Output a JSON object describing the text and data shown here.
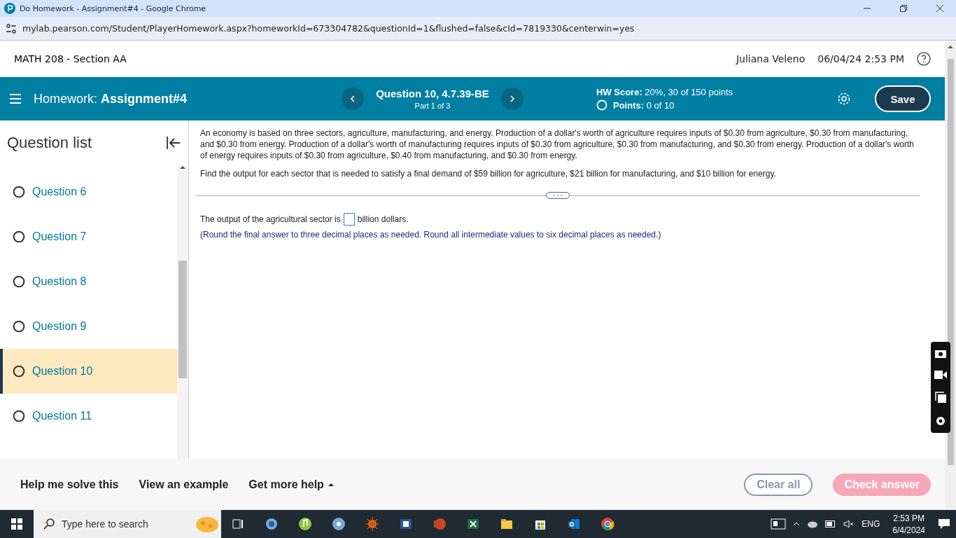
{
  "browser": {
    "title": "Do Homework - Assignment#4 - Google Chrome",
    "url": "mylab.pearson.com/Student/PlayerHomework.aspx?homeworkId=673304782&questionId=1&flushed=false&cId=7819330&centerwin=yes"
  },
  "header": {
    "course": "MATH 208 - Section AA",
    "user": "Juliana Veleno",
    "datetime": "06/04/24 2:53 PM"
  },
  "toolbar": {
    "homework_label": "Homework:",
    "assignment": "Assignment#4",
    "question_title": "Question 10, 4.7.39-BE",
    "part": "Part 1 of 3",
    "hw_score_label": "HW Score:",
    "hw_score": "20%, 30 of 150 points",
    "points_label": "Points:",
    "points": "0 of 10",
    "save": "Save"
  },
  "sidebar": {
    "title": "Question list",
    "items": [
      {
        "label": "Question 6",
        "selected": false
      },
      {
        "label": "Question 7",
        "selected": false
      },
      {
        "label": "Question 8",
        "selected": false
      },
      {
        "label": "Question 9",
        "selected": false
      },
      {
        "label": "Question 10",
        "selected": true
      },
      {
        "label": "Question 11",
        "selected": false
      }
    ]
  },
  "question": {
    "paragraphs": [
      "An economy is based on three sectors, agriculture, manufacturing, and energy. Production of a dollar's worth of agriculture requires inputs of $0.30 from agriculture,  $0.30 from manufacturing, and $0.30 from energy. Production of a dollar's worth of manufacturing requires inputs of $0.30 from agriculture, $0.30 from manufacturing, and $0.30 from energy. Production of a dollar's worth of energy requires inputs of $0.30 from agriculture, $0.40 from manufacturing, and $0.30 from energy.",
      "Find the output for each sector that is needed to satisfy a final demand of $59 billion for agriculture, $21 billion for manufacturing, and $10 billion for energy."
    ],
    "answer_prefix": "The output of the agricultural sector is",
    "answer_suffix": "billion dollars.",
    "note": "(Round the final answer to three decimal places as needed. Round all intermediate values to six decimal places as needed.)"
  },
  "footer": {
    "links": [
      "Help me solve this",
      "View an example",
      "Get more help"
    ],
    "buttons": [
      {
        "label": "Clear all",
        "kind": "outline",
        "disabled": true
      },
      {
        "label": "Check answer",
        "kind": "primary",
        "disabled": true
      }
    ]
  },
  "taskbar": {
    "search_placeholder": "Type here to search",
    "language": "ENG",
    "time": "2:53 PM",
    "date": "6/4/2024"
  }
}
